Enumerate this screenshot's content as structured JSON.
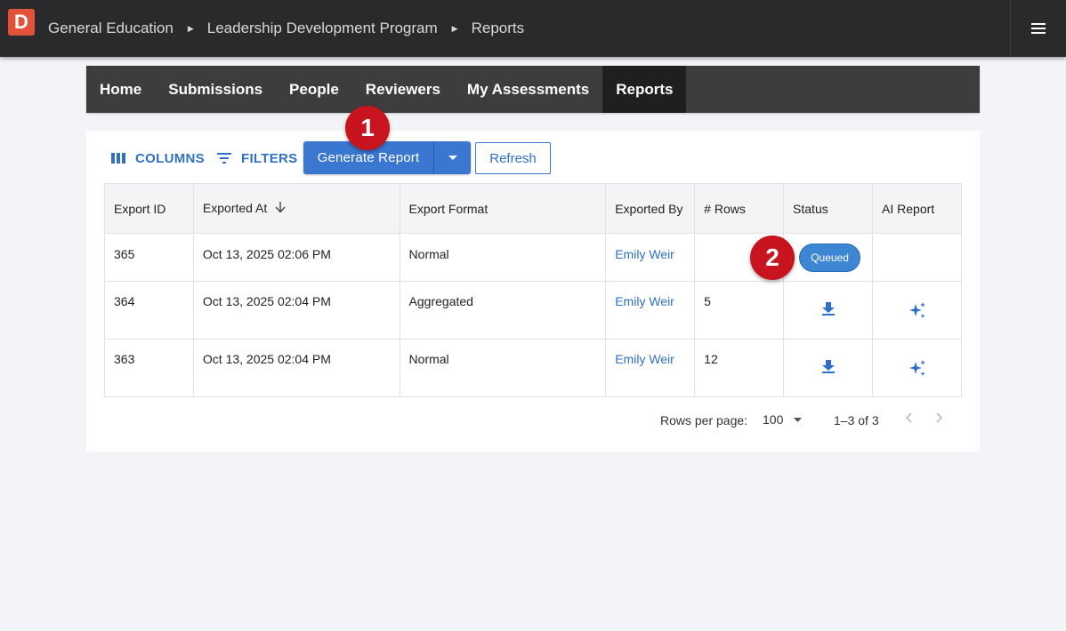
{
  "app": {
    "logo_letter": "D",
    "breadcrumbs": [
      "General Education",
      "Leadership Development Program",
      "Reports"
    ]
  },
  "nav": {
    "tabs": [
      "Home",
      "Submissions",
      "People",
      "Reviewers",
      "My Assessments",
      "Reports"
    ],
    "active": "Reports"
  },
  "toolbar": {
    "columns_label": "COLUMNS",
    "filters_label": "FILTERS",
    "generate_label": "Generate Report",
    "refresh_label": "Refresh"
  },
  "table": {
    "headers": [
      "Export ID",
      "Exported At",
      "Export Format",
      "Exported By",
      "# Rows",
      "Status",
      "AI Report"
    ],
    "rows": [
      {
        "id": "365",
        "exported_at": "Oct 13, 2025 02:06 PM",
        "format": "Normal",
        "by": "Emily Weir",
        "rows": "",
        "status": "Queued",
        "ai": ""
      },
      {
        "id": "364",
        "exported_at": "Oct 13, 2025 02:04 PM",
        "format": "Aggregated",
        "by": "Emily Weir",
        "rows": "5",
        "status": "download-icon",
        "ai": "sparkle-icon"
      },
      {
        "id": "363",
        "exported_at": "Oct 13, 2025 02:04 PM",
        "format": "Normal",
        "by": "Emily Weir",
        "rows": "12",
        "status": "download-icon",
        "ai": "sparkle-icon"
      }
    ]
  },
  "pagination": {
    "rows_per_page_label": "Rows per page:",
    "rows_per_page_value": "100",
    "range_text": "1–3 of 3"
  },
  "markers": {
    "m1": "1",
    "m2": "2"
  },
  "colors": {
    "accent": "#3a77d0",
    "marker": "#c8141e",
    "logo": "#e2513a"
  }
}
